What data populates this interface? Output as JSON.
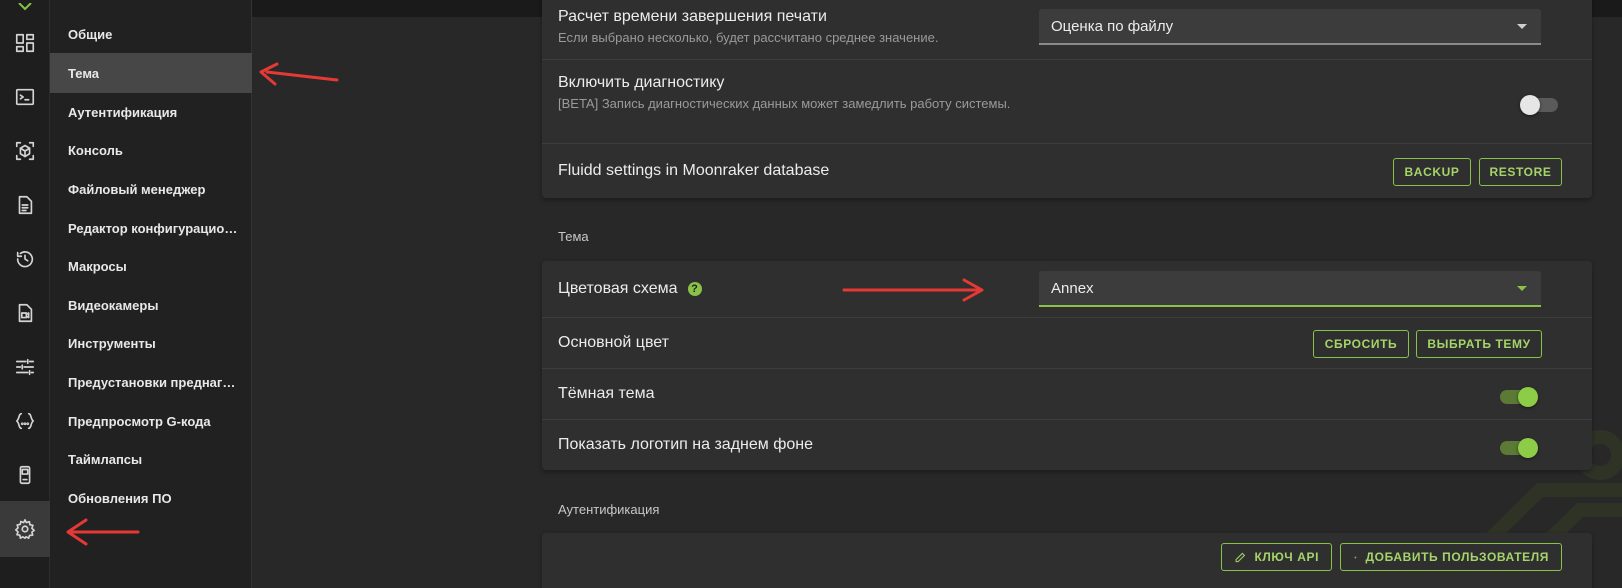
{
  "rail": {
    "items": [
      {
        "icon": "dashboard-icon"
      },
      {
        "icon": "console-icon"
      },
      {
        "icon": "cube-icon"
      },
      {
        "icon": "file-list-icon"
      },
      {
        "icon": "history-icon"
      },
      {
        "icon": "camera-file-icon"
      },
      {
        "icon": "sliders-icon"
      },
      {
        "icon": "code-braces-icon"
      },
      {
        "icon": "device-icon"
      },
      {
        "icon": "gear-icon",
        "active": true
      }
    ]
  },
  "nav": {
    "items": [
      {
        "label": "Общие"
      },
      {
        "label": "Тема",
        "active": true
      },
      {
        "label": "Аутентификация"
      },
      {
        "label": "Консоль"
      },
      {
        "label": "Файловый менеджер"
      },
      {
        "label": "Редактор конфигурационных файлов"
      },
      {
        "label": "Макросы"
      },
      {
        "label": "Видеокамеры"
      },
      {
        "label": "Инструменты"
      },
      {
        "label": "Предустановки преднагрева"
      },
      {
        "label": "Предпросмотр G-кода"
      },
      {
        "label": "Таймлапсы"
      },
      {
        "label": "Обновления ПО"
      }
    ]
  },
  "general": {
    "print_time": {
      "title": "Расчет времени завершения печати",
      "subtitle": "Если выбрано несколько, будет рассчитано среднее значение.",
      "value": "Оценка по файлу"
    },
    "diagnostics": {
      "title": "Включить диагностику",
      "subtitle": "[BETA] Запись диагностических данных может замедлить работу системы.",
      "enabled": false
    },
    "db": {
      "title": "Fluidd settings in Moonraker database",
      "backup_label": "BACKUP",
      "restore_label": "RESTORE"
    }
  },
  "theme": {
    "section_title": "Тема",
    "color_scheme": {
      "title": "Цветовая схема",
      "help": "?",
      "value": "Annex"
    },
    "primary_color": {
      "title": "Основной цвет",
      "reset_label": "СБРОСИТЬ",
      "choose_label": "ВЫБРАТЬ ТЕМУ"
    },
    "dark_theme": {
      "title": "Тёмная тема",
      "enabled": true
    },
    "show_logo": {
      "title": "Показать логотип на заднем фоне",
      "enabled": true
    }
  },
  "auth": {
    "section_title": "Аутентификация",
    "api_key_label": "КЛЮЧ API",
    "add_user_label": "ДОБАВИТЬ ПОЛЬЗОВАТЕЛЯ"
  },
  "colors": {
    "accent": "#88c248",
    "annotation_arrow": "#e53935"
  }
}
